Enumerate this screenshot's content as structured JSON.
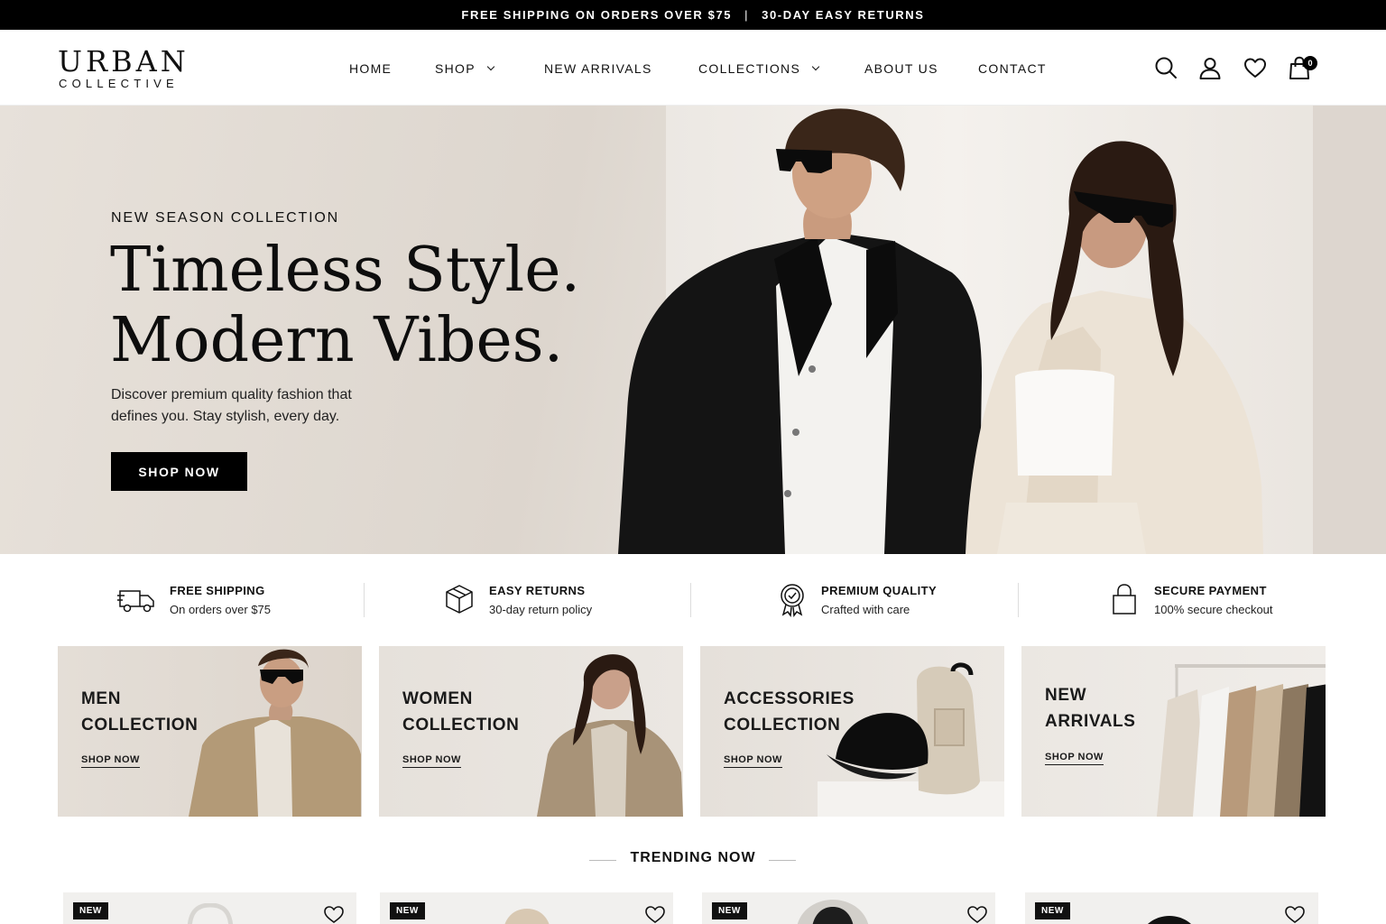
{
  "announcement": {
    "left": "FREE SHIPPING ON ORDERS OVER $75",
    "separator": "|",
    "right": "30-DAY EASY RETURNS"
  },
  "brand": {
    "name": "URBAN",
    "tagline": "COLLECTIVE"
  },
  "nav": [
    {
      "label": "HOME",
      "has_dropdown": false
    },
    {
      "label": "SHOP",
      "has_dropdown": true
    },
    {
      "label": "NEW ARRIVALS",
      "has_dropdown": false
    },
    {
      "label": "COLLECTIONS",
      "has_dropdown": true
    },
    {
      "label": "ABOUT US",
      "has_dropdown": false
    },
    {
      "label": "CONTACT",
      "has_dropdown": false
    }
  ],
  "header_icons": [
    "search-icon",
    "account-icon",
    "wishlist-icon",
    "cart-icon"
  ],
  "cart_count": "0",
  "hero": {
    "eyebrow": "NEW SEASON COLLECTION",
    "title_line1": "Timeless Style.",
    "title_line2": "Modern Vibes.",
    "text_line1": "Discover premium quality fashion that",
    "text_line2": "defines you. Stay stylish, every day.",
    "cta": "SHOP NOW"
  },
  "features": [
    {
      "icon": "truck-icon",
      "title": "FREE SHIPPING",
      "subtitle": "On orders over $75"
    },
    {
      "icon": "box-icon",
      "title": "EASY RETURNS",
      "subtitle": "30-day return policy"
    },
    {
      "icon": "badge-icon",
      "title": "PREMIUM QUALITY",
      "subtitle": "Crafted with care"
    },
    {
      "icon": "lock-icon",
      "title": "SECURE PAYMENT",
      "subtitle": "100% secure checkout"
    }
  ],
  "categories": [
    {
      "line1": "MEN",
      "line2": "COLLECTION",
      "link": "SHOP NOW"
    },
    {
      "line1": "WOMEN",
      "line2": "COLLECTION",
      "link": "SHOP NOW"
    },
    {
      "line1": "ACCESSORIES",
      "line2": "COLLECTION",
      "link": "SHOP NOW"
    },
    {
      "line1": "NEW",
      "line2": "ARRIVALS",
      "link": "SHOP NOW"
    }
  ],
  "trending": {
    "title": "TRENDING NOW",
    "products": [
      {
        "badge": "NEW"
      },
      {
        "badge": "NEW"
      },
      {
        "badge": "NEW"
      },
      {
        "badge": "NEW"
      }
    ]
  },
  "colors": {
    "accent": "#000000",
    "hero_bg": "#e2dcd4",
    "card_bg": "#e6e1db",
    "product_bg": "#f1f0ee"
  }
}
